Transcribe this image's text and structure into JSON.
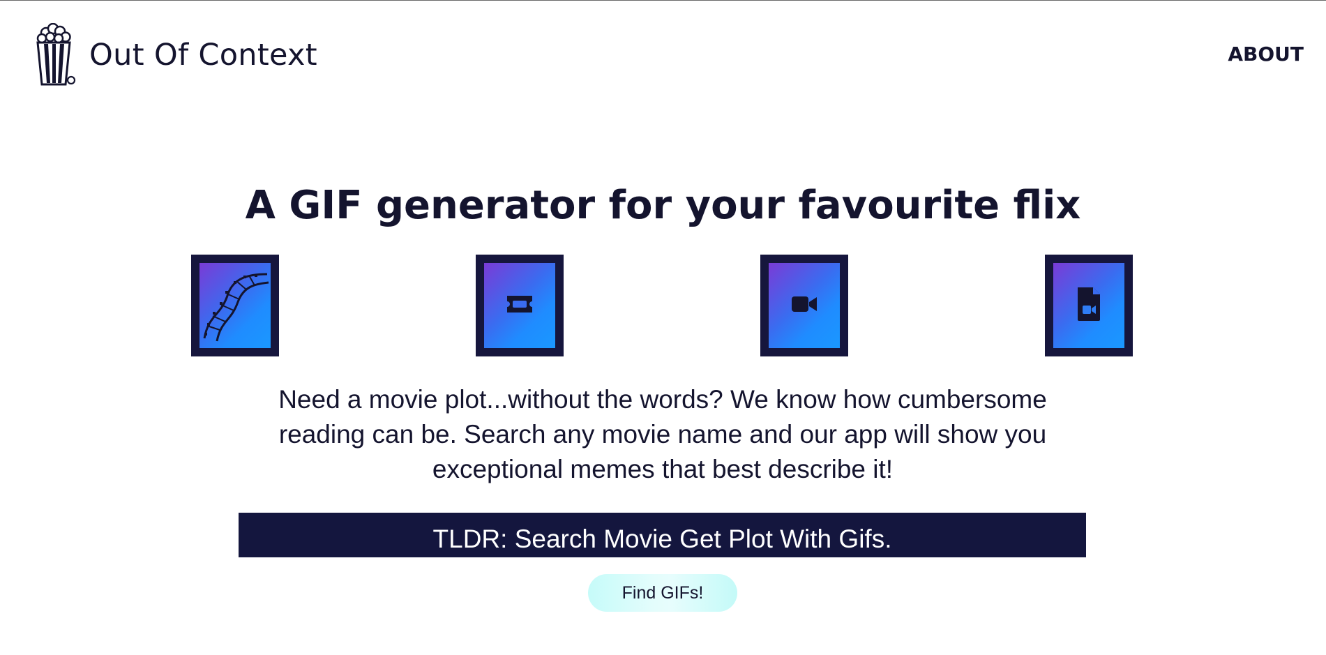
{
  "header": {
    "brand_name": "Out Of Context",
    "logo_icon": "popcorn-icon",
    "nav": {
      "about_label": "ABOUT"
    }
  },
  "hero": {
    "title": "A GIF generator for your favourite flix",
    "tiles": [
      {
        "icon": "film-strip-icon"
      },
      {
        "icon": "ticket-icon"
      },
      {
        "icon": "video-camera-icon"
      },
      {
        "icon": "video-file-icon"
      }
    ],
    "description": "Need a movie plot...without the words? We know how cumbersome reading can be. Search any movie name and our app will show you exceptional memes that best describe it!",
    "tldr": "TLDR: Search Movie Get Plot With Gifs.",
    "cta_label": "Find GIFs!"
  },
  "colors": {
    "text": "#14142e",
    "tile_frame": "#16163d",
    "tile_gradient_start": "#7a3bd6",
    "tile_gradient_end": "#1a98ff",
    "tldr_bg": "#14163e",
    "cta_bg": "#c6fbf9"
  }
}
